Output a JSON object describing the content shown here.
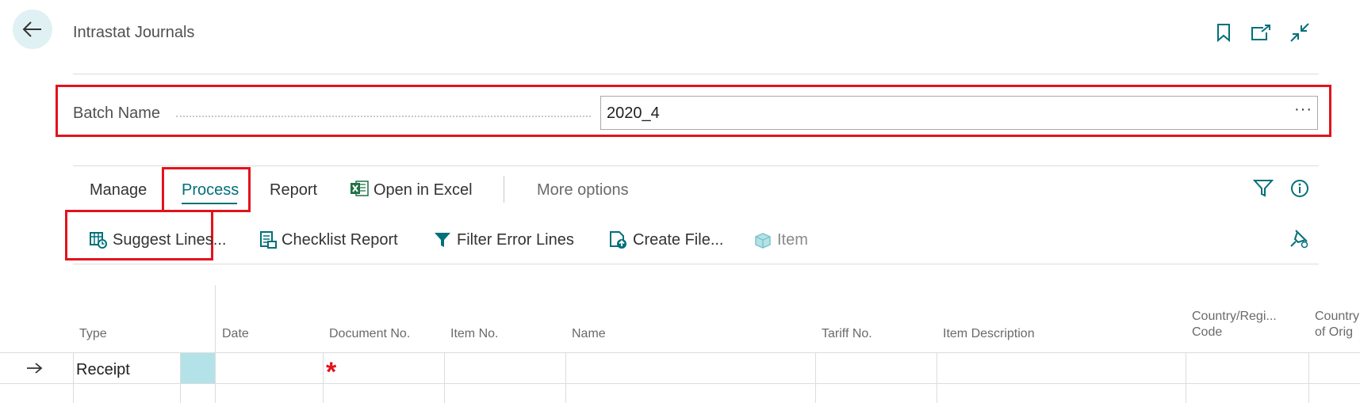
{
  "header": {
    "title": "Intrastat Journals",
    "icons": [
      "back-arrow-icon",
      "bookmark-icon",
      "open-new-window-icon",
      "collapse-icon"
    ]
  },
  "batch": {
    "label": "Batch Name",
    "value": "2020_4",
    "ellipsis": "···"
  },
  "menu": {
    "tabs": [
      {
        "label": "Manage"
      },
      {
        "label": "Process",
        "active": true
      },
      {
        "label": "Report"
      },
      {
        "label": "Open in Excel"
      }
    ],
    "more": "More options"
  },
  "actions": [
    {
      "label": "Suggest Lines...",
      "icon": "suggest-lines-icon"
    },
    {
      "label": "Checklist Report",
      "icon": "checklist-report-icon"
    },
    {
      "label": "Filter Error Lines",
      "icon": "filter-icon"
    },
    {
      "label": "Create File...",
      "icon": "create-file-icon"
    },
    {
      "label": "Item",
      "icon": "item-icon",
      "disabled": true
    }
  ],
  "table": {
    "columns": {
      "type": "Type",
      "date": "Date",
      "doc_no": "Document No.",
      "item_no": "Item No.",
      "name": "Name",
      "tariff": "Tariff No.",
      "item_desc": "Item Description",
      "country_line1": "Country/Regi...",
      "country_line2": "Code",
      "origin_line1": "Country",
      "origin_line2": "of Orig"
    },
    "rows": [
      {
        "type": "Receipt",
        "required_marker": "*"
      }
    ]
  },
  "colors": {
    "accent": "#00707a",
    "highlight": "#e2131d",
    "selected_cell": "#b3e3e8",
    "back_button_bg": "#dff1f3"
  }
}
